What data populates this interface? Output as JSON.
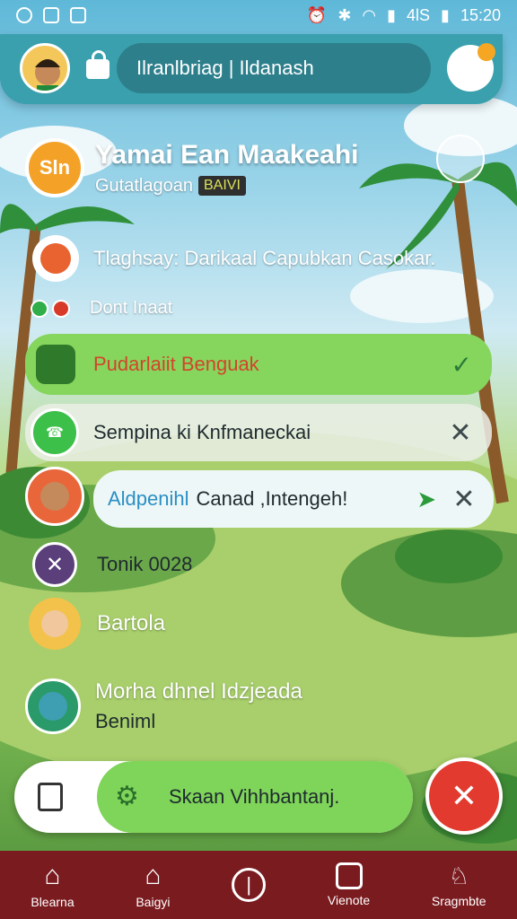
{
  "status_bar": {
    "left_icons": [
      "location-icon",
      "gallery-icon",
      "chat-bubble-icon"
    ],
    "right_icons": [
      "alarm-icon",
      "bluetooth-icon",
      "wifi-icon",
      "signal-icon"
    ],
    "network_label": "4lS",
    "battery_icon": "battery-icon",
    "time": "15:20"
  },
  "top_bar": {
    "search_text": "Ilranlbriag | Ildanash",
    "left_icon": "lock-icon",
    "right_icon": "mascot-icon"
  },
  "items": [
    {
      "title": "Yamai Ean Maakeahi",
      "subtitle": "Gutatlagoan",
      "badge": "BAIVI",
      "avatar_text": "Sln",
      "right_icon": "record-icon"
    },
    {
      "text": "Tlaghsay: Darikaal Capubkan Casokar.",
      "icon": "heart-icon"
    },
    {
      "text": "Dont Inaat",
      "icons": [
        "green-dot",
        "red-dot"
      ]
    },
    {
      "text": "Pudarlaiit Benguak",
      "icon": "robot-face-icon",
      "right_icon": "check-icon"
    },
    {
      "text": "Sempina ki Knfmaneckai",
      "icon": "phone-icon",
      "right_icon": "close-icon"
    },
    {
      "highlight": "Aldpenihl",
      "text": "Canad ,Intengeh!",
      "icon": "send-icon",
      "right_icon": "close-icon"
    },
    {
      "text": "Tonik 0028",
      "icon": "cross-icon"
    },
    {
      "text": "Bartola",
      "icon": "avatar-icon"
    },
    {
      "text": "Morha dhnel Idzjeada",
      "subtitle": "Beniml",
      "icon": "alien-icon"
    }
  ],
  "action_bar": {
    "text": "Skaan Vihhbantanj.",
    "left_icon": "clipboard-icon",
    "inner_icon": "gear-icon",
    "fab_icon": "close-icon"
  },
  "bottom_nav": [
    {
      "label": "Blearna",
      "icon": "home-icon"
    },
    {
      "label": "Baigyi",
      "icon": "home-icon"
    },
    {
      "label": "",
      "icon": "power-icon"
    },
    {
      "label": "Vienote",
      "icon": "box-icon"
    },
    {
      "label": "Sragmbte",
      "icon": "person-icon"
    }
  ],
  "colors": {
    "top_bar": "#3aa0ad",
    "search": "#2d7f8c",
    "bottom_nav": "#7a1b1f",
    "accent_green": "#7fd45a",
    "fab_red": "#e23a2e"
  }
}
